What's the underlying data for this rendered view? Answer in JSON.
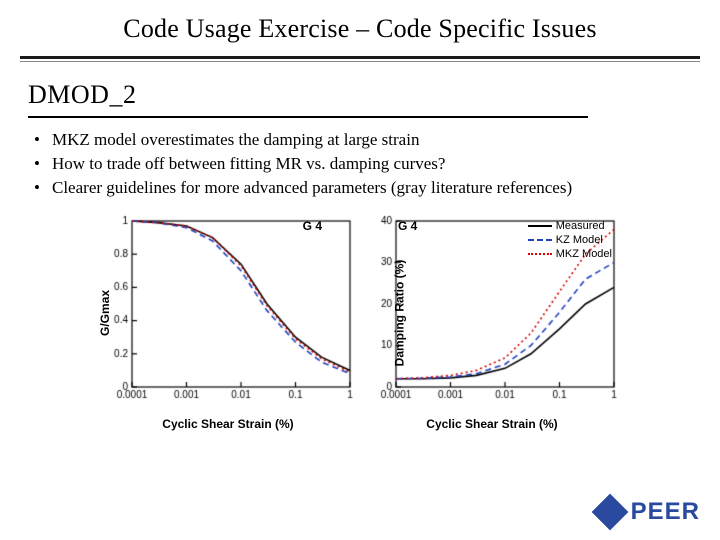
{
  "title": "Code Usage Exercise – Code Specific Issues",
  "subtitle": "DMOD_2",
  "bullets": [
    "MKZ model overestimates the damping at large strain",
    "How to trade off between fitting MR vs. damping curves?",
    "Clearer guidelines for more advanced parameters (gray literature references)"
  ],
  "logo": {
    "text": "PEER"
  },
  "legend": {
    "measured": "Measured",
    "kz": "KZ Model",
    "mkz": "MKZ Model"
  },
  "panel_label": "G 4",
  "chart_data": [
    {
      "type": "line",
      "title": "G 4",
      "xlabel": "Cyclic Shear Strain (%)",
      "ylabel": "G/Gmax",
      "xscale": "log",
      "xlim": [
        0.0001,
        1
      ],
      "ylim": [
        0,
        1
      ],
      "xticks": [
        0.0001,
        0.001,
        0.01,
        0.1,
        1
      ],
      "yticks": [
        0,
        0.2,
        0.4,
        0.6,
        0.8,
        1
      ],
      "series": [
        {
          "name": "Measured",
          "style": "solid",
          "color": "#000000",
          "x": [
            0.0001,
            0.0003,
            0.001,
            0.003,
            0.01,
            0.03,
            0.1,
            0.3,
            1
          ],
          "y": [
            1.0,
            0.99,
            0.97,
            0.9,
            0.74,
            0.5,
            0.3,
            0.18,
            0.1
          ]
        },
        {
          "name": "KZ Model",
          "style": "dashed",
          "color": "#2040c0",
          "x": [
            0.0001,
            0.0003,
            0.001,
            0.003,
            0.01,
            0.03,
            0.1,
            0.3,
            1
          ],
          "y": [
            1.0,
            0.99,
            0.96,
            0.88,
            0.7,
            0.46,
            0.27,
            0.15,
            0.08
          ]
        },
        {
          "name": "MKZ Model",
          "style": "dotted",
          "color": "#d00000",
          "x": [
            0.0001,
            0.0003,
            0.001,
            0.003,
            0.01,
            0.03,
            0.1,
            0.3,
            1
          ],
          "y": [
            1.0,
            0.99,
            0.97,
            0.9,
            0.73,
            0.49,
            0.29,
            0.17,
            0.09
          ]
        }
      ]
    },
    {
      "type": "line",
      "title": "G 4",
      "xlabel": "Cyclic Shear Strain (%)",
      "ylabel": "Damping Ratio (%)",
      "xscale": "log",
      "xlim": [
        0.0001,
        1
      ],
      "ylim": [
        0,
        40
      ],
      "xticks": [
        0.0001,
        0.001,
        0.01,
        0.1,
        1
      ],
      "yticks": [
        0,
        10,
        20,
        30,
        40
      ],
      "series": [
        {
          "name": "Measured",
          "style": "solid",
          "color": "#000000",
          "x": [
            0.0001,
            0.0003,
            0.001,
            0.003,
            0.01,
            0.03,
            0.1,
            0.3,
            1
          ],
          "y": [
            2.0,
            2.0,
            2.2,
            2.8,
            4.5,
            8.0,
            14.0,
            20.0,
            24.0
          ]
        },
        {
          "name": "KZ Model",
          "style": "dashed",
          "color": "#2040c0",
          "x": [
            0.0001,
            0.0003,
            0.001,
            0.003,
            0.01,
            0.03,
            0.1,
            0.3,
            1
          ],
          "y": [
            2.0,
            2.1,
            2.4,
            3.2,
            5.5,
            10.0,
            18.0,
            26.0,
            30.0
          ]
        },
        {
          "name": "MKZ Model",
          "style": "dotted",
          "color": "#d00000",
          "x": [
            0.0001,
            0.0003,
            0.001,
            0.003,
            0.01,
            0.03,
            0.1,
            0.3,
            1
          ],
          "y": [
            2.0,
            2.2,
            2.8,
            4.0,
            7.0,
            13.0,
            23.0,
            32.0,
            38.0
          ]
        }
      ]
    }
  ]
}
